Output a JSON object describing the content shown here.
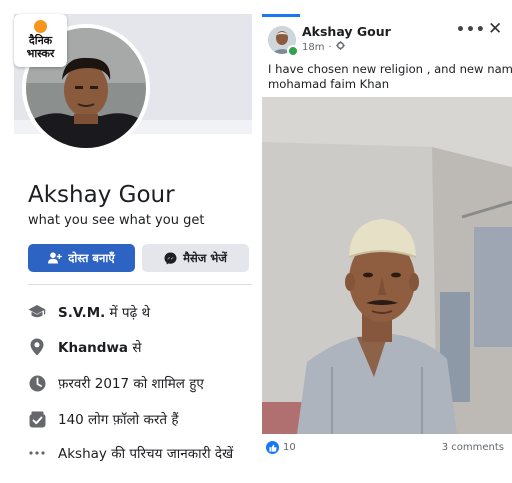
{
  "brand": {
    "line1": "दैनिक",
    "line2": "भास्कर"
  },
  "profile": {
    "name": "Akshay Gour",
    "bio": "what you see what you get",
    "add_friend_label": "दोस्त बनाएँ",
    "message_label": "मैसेज भेजें",
    "info": [
      {
        "icon": "graduation-cap-icon",
        "bold": "S.V.M.",
        "text": " में पढ़े थे"
      },
      {
        "icon": "location-pin-icon",
        "bold": "Khandwa",
        "text": " से"
      },
      {
        "icon": "clock-icon",
        "bold": "",
        "text": "फ़रवरी 2017 को शामिल हुए"
      },
      {
        "icon": "followers-icon",
        "bold": "",
        "text": "140 लोग फ़ॉलो करते हैं"
      },
      {
        "icon": "ellipsis-icon",
        "bold": "",
        "text": "Akshay की परिचय जानकारी देखें"
      }
    ]
  },
  "post": {
    "author": "Akshay Gour",
    "time": "18m",
    "privacy_icon": "gear-icon",
    "text_line1": "I have chosen new religion  , and new name",
    "text_line2": "mohamad faim Khan",
    "likes": "10",
    "comments": "3 comments",
    "more_label": "•••",
    "close_label": "✕"
  },
  "colors": {
    "primary_blue": "#2d63c3",
    "facebook_blue": "#1877f2",
    "online_green": "#31a24c",
    "logo_orange": "#f7941d"
  }
}
